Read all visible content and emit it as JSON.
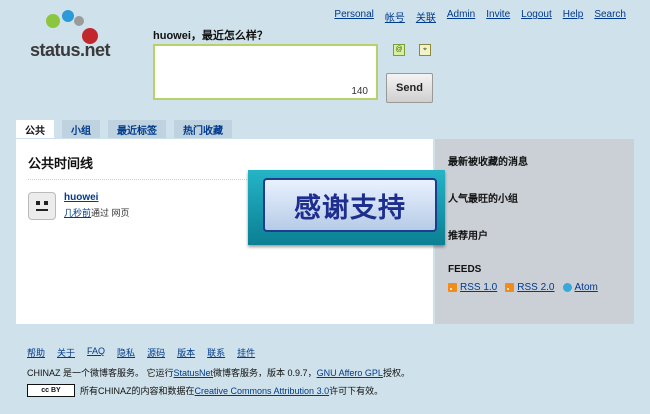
{
  "brand": {
    "name": "status.net"
  },
  "topnav": [
    "Personal",
    "帐号",
    "关联",
    "Admin",
    "Invite",
    "Logout",
    "Help",
    "Search"
  ],
  "notice_form": {
    "prompt": "huowei，最近怎么样？",
    "value": "",
    "char_count": "140",
    "send_label": "Send"
  },
  "tabs": [
    "公共",
    "小组",
    "最近标签",
    "热门收藏"
  ],
  "timeline": {
    "title": "公共时间线",
    "notices": [
      {
        "author": "huowei",
        "time": "几秒前",
        "via_prefix": "通过",
        "source": "网页"
      }
    ]
  },
  "sidebar": {
    "sections": [
      "最新被收藏的消息",
      "人气最旺的小组",
      "推荐用户",
      "FEEDS"
    ],
    "feeds": [
      "RSS 1.0",
      "RSS 2.0",
      "Atom"
    ]
  },
  "banner": {
    "text": "感谢支持"
  },
  "footer": {
    "links": [
      "帮助",
      "关于",
      "FAQ",
      "隐私",
      "源码",
      "版本",
      "联系",
      "挂件"
    ],
    "line1_pre": "CHINAZ 是一个微博客服务。 它运行",
    "line1_link": "StatusNet",
    "line1_mid": "微博客服务，版本 0.9.7，",
    "line1_link2": "GNU Affero GPL",
    "line1_post": "授权。",
    "cc_badge": "cc BY",
    "line2_pre": "所有CHINAZ的内容和数据在",
    "line2_link": "Creative Commons Attribution 3.0",
    "line2_post": "许可下有效。"
  },
  "colors": {
    "background": "#cfe1ea",
    "link": "#003a8c",
    "banner": "#1d2e8f",
    "textarea_border": "#b6d36a"
  }
}
